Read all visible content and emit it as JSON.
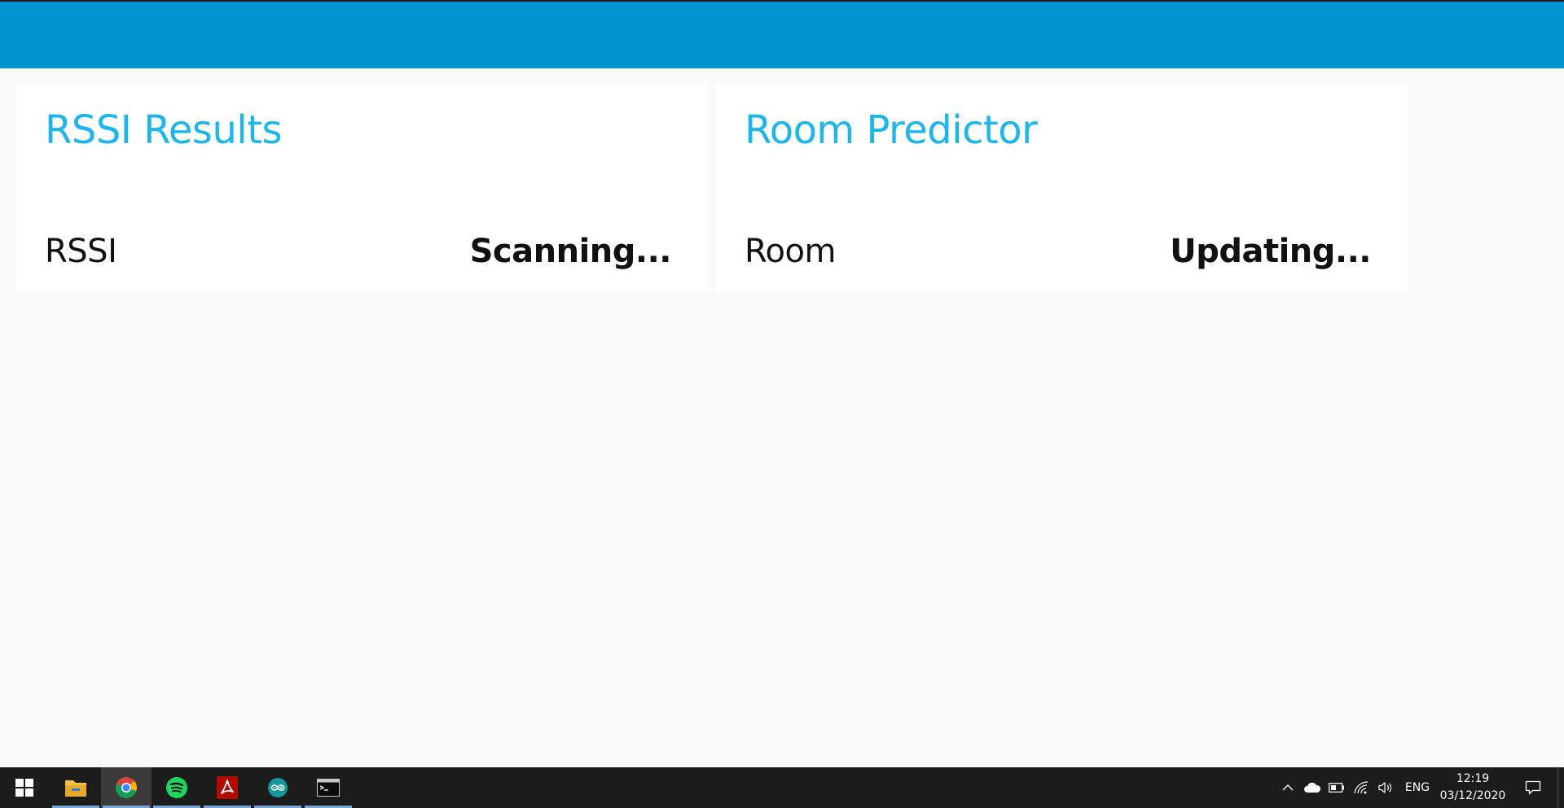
{
  "cards": {
    "rssi": {
      "title": "RSSI Results",
      "label": "RSSI",
      "value": "Scanning..."
    },
    "room": {
      "title": "Room Predictor",
      "label": "Room",
      "value": "Updating..."
    }
  },
  "colors": {
    "topbar": "#0095d0",
    "card_title": "#1ab6ef",
    "background": "#f9f9f9",
    "taskbar": "#1c1c1c"
  },
  "taskbar": {
    "apps": [
      {
        "icon": "file-explorer-icon"
      },
      {
        "icon": "chrome-icon",
        "active": true
      },
      {
        "icon": "spotify-icon"
      },
      {
        "icon": "acrobat-icon"
      },
      {
        "icon": "arduino-icon"
      },
      {
        "icon": "terminal-icon"
      }
    ],
    "tray_icons": [
      "chevron-up-icon",
      "onedrive-icon",
      "battery-icon",
      "wifi-icon",
      "volume-icon"
    ],
    "language": "ENG",
    "time": "12:19",
    "date": "03/12/2020"
  }
}
